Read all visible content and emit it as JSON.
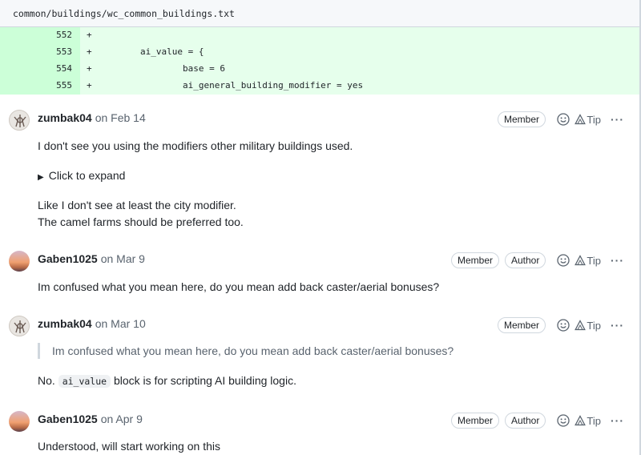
{
  "file": {
    "path": "common/buildings/wc_common_buildings.txt"
  },
  "diff": {
    "rows": [
      {
        "num": "552",
        "sign": "+",
        "code": ""
      },
      {
        "num": "553",
        "sign": "+",
        "code": "        ai_value = {"
      },
      {
        "num": "554",
        "sign": "+",
        "code": "                base = 6"
      },
      {
        "num": "555",
        "sign": "+",
        "code": "                ai_general_building_modifier = yes"
      }
    ]
  },
  "comments": [
    {
      "author": "zumbak04",
      "date": "on Feb 14",
      "badges": [
        "Member"
      ],
      "tip": "Tip",
      "body1": "I don't see you using the modifiers other military buildings used.",
      "expand": "Click to expand",
      "body2": "Like I don't see at least the city modifier.",
      "body3": "The camel farms should be preferred too."
    },
    {
      "author": "Gaben1025",
      "date": "on Mar 9",
      "badges": [
        "Member",
        "Author"
      ],
      "tip": "Tip",
      "body1": "Im confused what you mean here, do you mean add back caster/aerial bonuses?"
    },
    {
      "author": "zumbak04",
      "date": "on Mar 10",
      "badges": [
        "Member"
      ],
      "tip": "Tip",
      "quote": "Im confused what you mean here, do you mean add back caster/aerial bonuses?",
      "body_pre": "No.",
      "code": "ai_value",
      "body_post": "block is for scripting AI building logic."
    },
    {
      "author": "Gaben1025",
      "date": "on Apr 9",
      "badges": [
        "Member",
        "Author"
      ],
      "tip": "Tip",
      "body1": "Understood, will start working on this"
    }
  ],
  "icons": {
    "reaction": "smiley-icon",
    "tip": "tip-icon",
    "more": "kebab-icon"
  },
  "colors": {
    "diff_add_bg": "#e6ffec",
    "diff_num_bg": "#ccffd8"
  }
}
